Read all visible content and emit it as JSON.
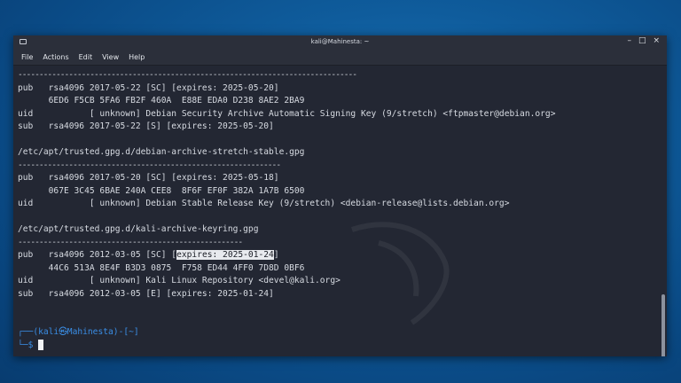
{
  "window": {
    "title": "kali@Mahinesta: ~",
    "controls": [
      "–",
      "□",
      "×"
    ]
  },
  "menu": [
    "File",
    "Actions",
    "Edit",
    "View",
    "Help"
  ],
  "terminal": {
    "lines": [
      {
        "kind": "dash",
        "text": "--------------------------------------------------------------------------------"
      },
      {
        "kind": "text",
        "text": "pub   rsa4096 2017-05-22 [SC] [expires: 2025-05-20]"
      },
      {
        "kind": "text",
        "text": "      6ED6 F5CB 5FA6 FB2F 460A  E88E EDA0 D238 8AE2 2BA9"
      },
      {
        "kind": "text",
        "text": "uid           [ unknown] Debian Security Archive Automatic Signing Key (9/stretch) <ftpmaster@debian.org>"
      },
      {
        "kind": "text",
        "text": "sub   rsa4096 2017-05-22 [S] [expires: 2025-05-20]"
      },
      {
        "kind": "blank",
        "text": ""
      },
      {
        "kind": "text",
        "text": "/etc/apt/trusted.gpg.d/debian-archive-stretch-stable.gpg"
      },
      {
        "kind": "dash",
        "text": "--------------------------------------------------------------"
      },
      {
        "kind": "text",
        "text": "pub   rsa4096 2017-05-20 [SC] [expires: 2025-05-18]"
      },
      {
        "kind": "text",
        "text": "      067E 3C45 6BAE 240A CEE8  8F6F EF0F 382A 1A7B 6500"
      },
      {
        "kind": "text",
        "text": "uid           [ unknown] Debian Stable Release Key (9/stretch) <debian-release@lists.debian.org>"
      },
      {
        "kind": "blank",
        "text": ""
      },
      {
        "kind": "text",
        "text": "/etc/apt/trusted.gpg.d/kali-archive-keyring.gpg"
      },
      {
        "kind": "dash",
        "text": "-----------------------------------------------------"
      },
      {
        "kind": "highlight",
        "before": "pub   rsa4096 2012-03-05 [SC] [",
        "hl": "expires: 2025-01-24",
        "after": "]"
      },
      {
        "kind": "text",
        "text": "      44C6 513A 8E4F B3D3 0875  F758 ED44 4FF0 7D8D 0BF6"
      },
      {
        "kind": "text",
        "text": "uid           [ unknown] Kali Linux Repository <devel@kali.org>"
      },
      {
        "kind": "text",
        "text": "sub   rsa4096 2012-03-05 [E] [expires: 2025-01-24]"
      },
      {
        "kind": "blank",
        "text": ""
      },
      {
        "kind": "blank",
        "text": ""
      }
    ],
    "prompt": {
      "open": "┌──(",
      "user": "kali㉿Mahinesta",
      "close": ")-[~]",
      "second": "└─",
      "dollar": "$"
    }
  },
  "colors": {
    "accent": "#3a8ee6",
    "terminal_bg": "#232733",
    "desktop_bg": "#0f5c9c"
  }
}
